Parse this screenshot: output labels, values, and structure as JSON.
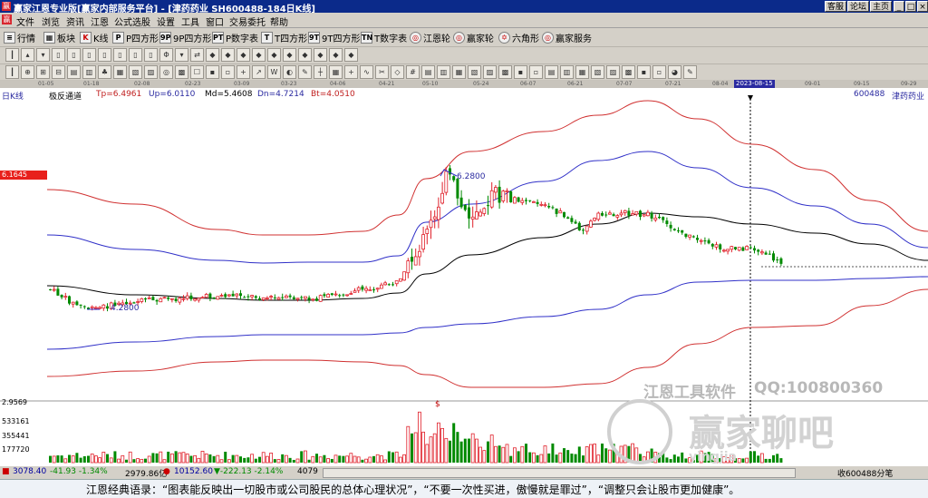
{
  "window": {
    "title": "赢家江恩专业版[赢家内部服务平台] - [津药药业  SH600488-184日K线]",
    "buttons": [
      "客服",
      "论坛",
      "主页",
      "_",
      "□",
      "×"
    ]
  },
  "menu": [
    "文件",
    "浏览",
    "资讯",
    "江恩",
    "公式选股",
    "设置",
    "工具",
    "窗口",
    "交易委托",
    "帮助"
  ],
  "toolbar1": [
    "行情",
    "板块",
    "K线",
    "P四方形",
    "9P四方形",
    "P数字表",
    "T四方形",
    "9T四方形",
    "T数字表",
    "江恩轮",
    "赢家轮",
    "六角形",
    "赢家服务"
  ],
  "toolbar1_icon_text": [
    "≡",
    "▦",
    "K",
    "P",
    "9P",
    "PT",
    "T",
    "9T",
    "TN",
    "◎",
    "◎",
    "✡",
    "◎"
  ],
  "toolbar2_glyphs": [
    "┃",
    "▴",
    "▾",
    "▯",
    "▯",
    "▯",
    "▯",
    "▯",
    "▯",
    "▯",
    "Φ",
    "▾",
    "⇄",
    "◆",
    "◆",
    "◆",
    "◆",
    "◆",
    "◆",
    "◆",
    "◆",
    "◆",
    "◆"
  ],
  "toolbar3_glyphs": [
    "┃",
    "⊕",
    "⊞",
    "⊟",
    "▤",
    "▥",
    "♣",
    "▦",
    "▧",
    "▨",
    "◎",
    "▩",
    "☐",
    "▪",
    "▫",
    "+",
    "↗",
    "W",
    "◐",
    "✎",
    "┼",
    "▦",
    "+",
    "∿",
    "✂",
    "◇",
    "#",
    "▤",
    "▥",
    "▦",
    "▧",
    "▨",
    "▩",
    "▪",
    "▫",
    "▤",
    "▥",
    "▦",
    "▧",
    "▨",
    "▩",
    "▪",
    "▫",
    "◕",
    "✎"
  ],
  "dates": [
    "01-05",
    "01-18",
    "02-08",
    "02-23",
    "03-09",
    "03-23",
    "04-06",
    "04-21",
    "05-10",
    "05-24",
    "06-07",
    "06-21",
    "07-07",
    "07-21",
    "08-04",
    "09-01",
    "09-15",
    "09-29"
  ],
  "selected_date": "2023-08-15",
  "chart_label": "日K线",
  "indicator": {
    "name": "极反通道",
    "tp": "Tp=6.4961",
    "up": "Up=6.0110",
    "md": "Md=5.4608",
    "dn": "Dn=4.7214",
    "bt": "Bt=4.0510"
  },
  "stock": {
    "code": "600488",
    "name": "津药药业"
  },
  "price_tag": "6.1645",
  "annotations": {
    "high": "6.2800",
    "low": "4.2800",
    "volume_marker": "$"
  },
  "volume_axis": [
    "2.9569",
    "533161",
    "355441",
    "177720"
  ],
  "watermark": {
    "text1": "江恩工具软件",
    "text2": "QQ:100800360",
    "text3": "赢家聊吧",
    "text4": "yingjia"
  },
  "statusbar": {
    "idx1": "3078.40",
    "idx1_change": "-41.93 -1.34%",
    "idx1_amount": "2979.86亿",
    "idx2": "10152.60",
    "idx2_change": "▼-222.13 -2.14%",
    "idx2_amount": "4079",
    "right_text": "收600488分笔"
  },
  "footer": "江恩经典语录：“图表能反映出一切股市或公司股民的总体心理状况”，“不要一次性买进，傲慢就是罪过”，“调整只会让股市更加健康”。",
  "colors": {
    "up_candle": "#e0202a",
    "down_candle": "#008a00",
    "upper_band": "#d03030",
    "mid_band": "#3030c8",
    "center_line": "#000000"
  },
  "chart_data": {
    "type": "candlestick",
    "period": "daily",
    "x_range": [
      "01-05",
      "09-29"
    ],
    "price_range": [
      3.2,
      6.9
    ],
    "channels": {
      "tp": {
        "name": "Tp",
        "last": 6.4961
      },
      "up": {
        "name": "Up",
        "last": 6.011
      },
      "md": {
        "name": "Md",
        "last": 5.4608
      },
      "dn": {
        "name": "Dn",
        "last": 4.7214
      },
      "bt": {
        "name": "Bt",
        "last": 4.051
      }
    },
    "marked_high": 6.28,
    "marked_low": 4.28,
    "volume_max": 2.9569
  }
}
